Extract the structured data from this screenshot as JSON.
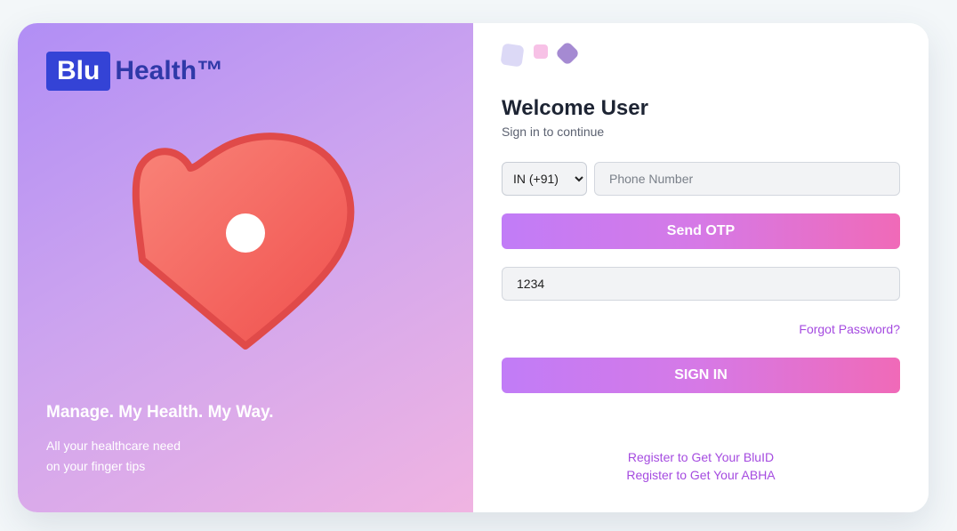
{
  "brand": {
    "logo_box_text": "Blu",
    "logo_text": "Health™",
    "logo_box_color": "#3443d6",
    "logo_text_color": "#2f39a8"
  },
  "hero": {
    "icon": "heart-icon",
    "tagline": "Manage. My Health. My Way.",
    "sub_line_1": "All your healthcare need",
    "sub_line_2": "on your finger tips"
  },
  "login": {
    "title": "Welcome User",
    "subtitle": "Sign in to continue",
    "country_code": "IN (+91)",
    "phone_placeholder": "Phone Number",
    "send_otp_label": "Send OTP",
    "otp_value": "1234",
    "forgot_label": "Forgot Password?",
    "signin_label": "SIGN IN",
    "register_bluid": "Register to Get Your BluID",
    "register_abha": "Register to Get Your ABHA"
  },
  "colors": {
    "accent": "#a54be0",
    "button_gradient_start": "#c17cf7",
    "button_gradient_end": "#f06ab8",
    "heart": "#f26060"
  }
}
